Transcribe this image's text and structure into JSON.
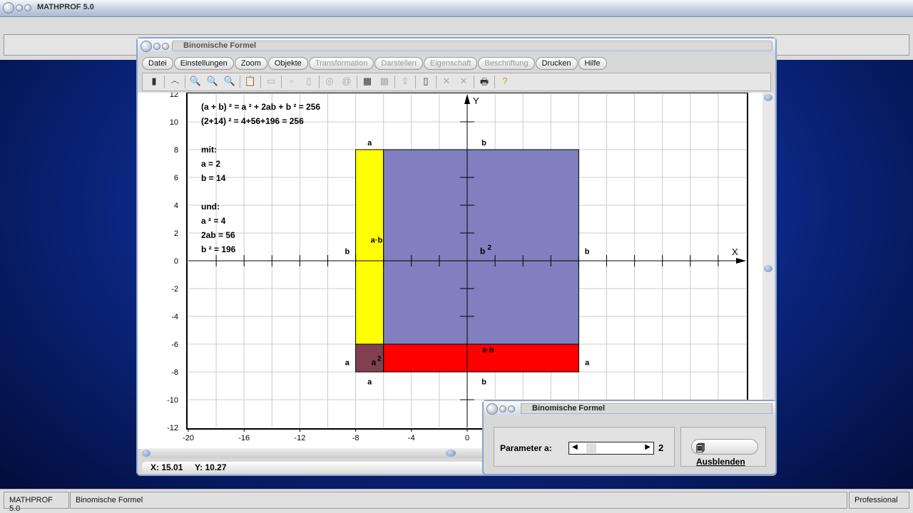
{
  "app": {
    "title": "MATHPROF 5.0"
  },
  "window": {
    "title": "Binomische Formel",
    "menu": [
      {
        "label": "Datei",
        "enabled": true
      },
      {
        "label": "Einstellungen",
        "enabled": true
      },
      {
        "label": "Zoom",
        "enabled": true
      },
      {
        "label": "Objekte",
        "enabled": true
      },
      {
        "label": "Transformation",
        "enabled": false
      },
      {
        "label": "Darstellen",
        "enabled": false
      },
      {
        "label": "Eigenschaft",
        "enabled": false
      },
      {
        "label": "Beschriftung",
        "enabled": false
      },
      {
        "label": "Drucken",
        "enabled": true
      },
      {
        "label": "Hilfe",
        "enabled": true
      }
    ],
    "coords": {
      "x": "X: 15.01",
      "y": "Y: 10.27"
    }
  },
  "plot": {
    "text_lines": [
      "(a + b) ² = a ² + 2ab + b ² = 256",
      "(2+14) ²  = 4+56+196 = 256",
      "",
      "mit:",
      "a = 2",
      "b = 14",
      "",
      "und:",
      "a ² = 4",
      "2ab = 56",
      "b ² = 196"
    ],
    "x_label": "X",
    "y_label": "Y",
    "x_ticks": [
      "-20",
      "-16",
      "-12",
      "-8",
      "-4",
      "0"
    ],
    "y_ticks": [
      "12",
      "10",
      "8",
      "6",
      "4",
      "2",
      "0",
      "-2",
      "-4",
      "-6",
      "-8",
      "-10",
      "-12"
    ],
    "labels": {
      "a": "a",
      "b": "b",
      "ab": "a·b",
      "a2": "a",
      "b2": "b",
      "sup": "2"
    },
    "colors": {
      "yellow": "#ffff00",
      "purple": "#8080c0",
      "brown": "#804050",
      "red": "#ff0000"
    }
  },
  "chart_data": {
    "type": "area",
    "xlim": [
      -20,
      20
    ],
    "ylim": [
      -12,
      12
    ],
    "grid": true,
    "rects": [
      {
        "name": "a·b",
        "x": [
          -8,
          -6
        ],
        "y": [
          -6,
          8
        ],
        "color": "#ffff00"
      },
      {
        "name": "b²",
        "x": [
          -6,
          8
        ],
        "y": [
          -6,
          8
        ],
        "color": "#8080c0"
      },
      {
        "name": "a²",
        "x": [
          -8,
          -6
        ],
        "y": [
          -8,
          -6
        ],
        "color": "#804050"
      },
      {
        "name": "a·b",
        "x": [
          -6,
          8
        ],
        "y": [
          -8,
          -6
        ],
        "color": "#ff0000"
      }
    ]
  },
  "dialog": {
    "title": "Binomische Formel",
    "param_label": "Parameter a:",
    "param_value": "2",
    "hide_button": "Ausblenden"
  },
  "statusbar": {
    "app": "MATHPROF 5.0",
    "doc": "Binomische Formel",
    "edition": "Professional"
  }
}
